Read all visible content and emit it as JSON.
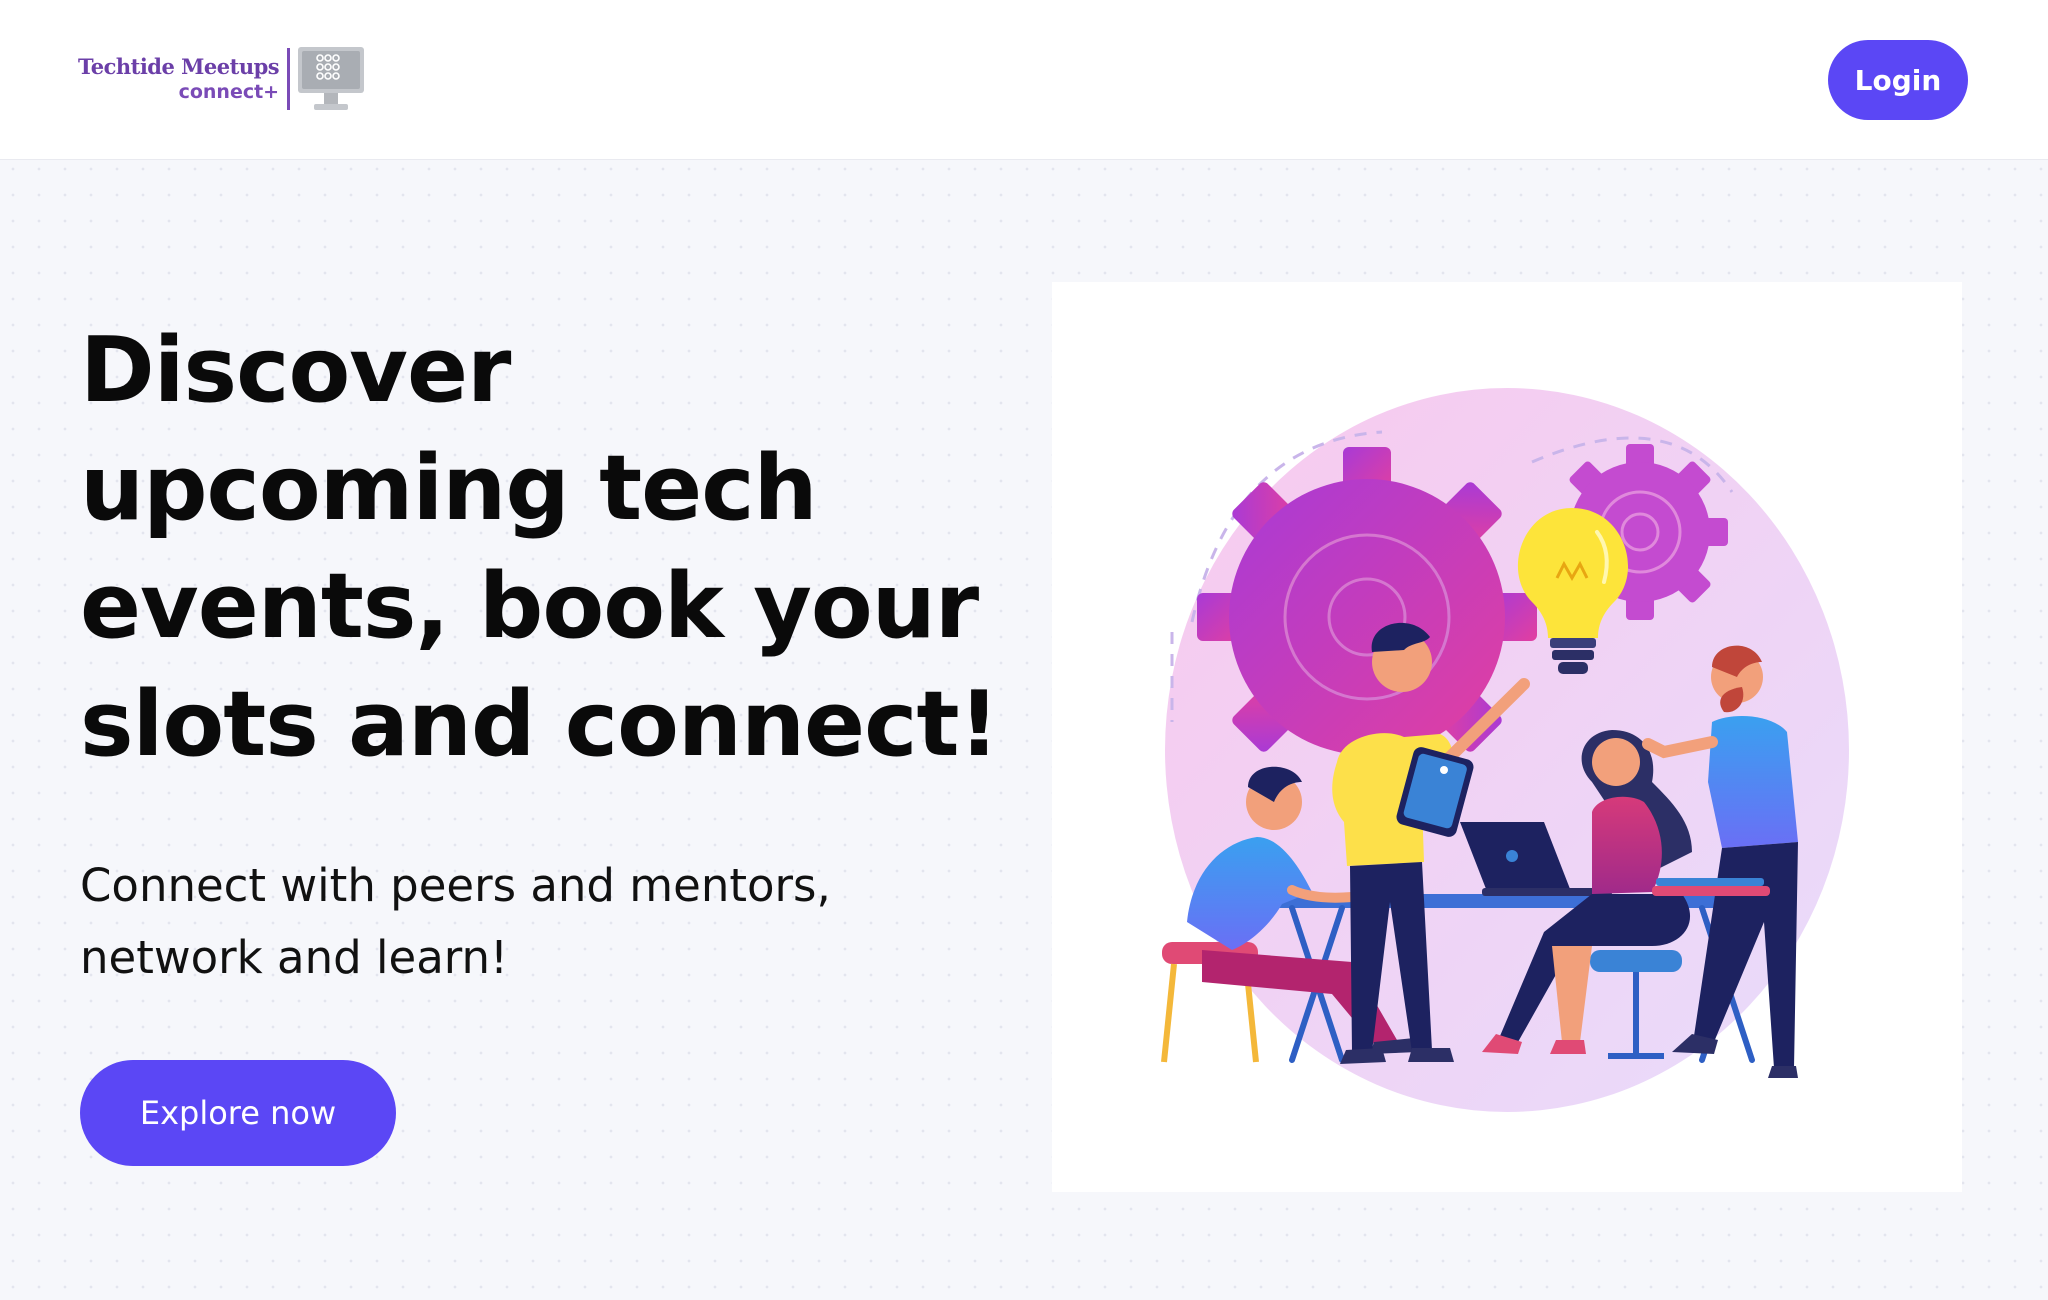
{
  "header": {
    "logo": {
      "name": "Techtide Meetups",
      "tagline": "connect+",
      "icon": "monitor-icon"
    },
    "login_label": "Login"
  },
  "hero": {
    "title": "Discover upcoming tech events, book your slots and connect!",
    "subtitle": "Connect with peers and mentors, network and learn!",
    "cta_label": "Explore now",
    "illustration": "team-collaboration-illustration"
  },
  "colors": {
    "accent": "#5b47f5",
    "brand": "#6b3fa8",
    "page_background": "#f6f7fb",
    "text": "#0a0a0a"
  }
}
